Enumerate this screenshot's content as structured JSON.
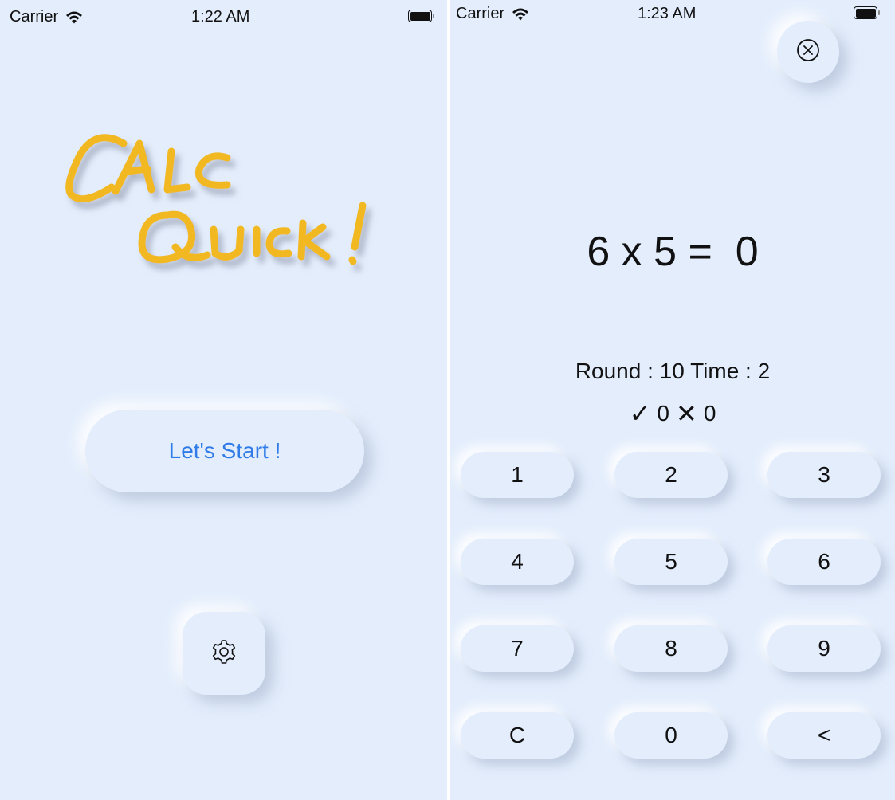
{
  "home": {
    "status_bar": {
      "carrier": "Carrier",
      "time": "1:22 AM"
    },
    "logo": {
      "line1": "CALC",
      "line2": "QUICK !",
      "color": "#f2b824"
    },
    "start_button_label": "Let's Start !",
    "settings_icon": "gear-icon",
    "accent_color": "#2f7be8"
  },
  "game": {
    "status_bar": {
      "carrier": "Carrier",
      "time": "1:23 AM"
    },
    "close_icon": "circled-x-icon",
    "equation": "6 x 5 =  0",
    "round_text": "Round : 10  Time : 2",
    "correct_symbol": "✓",
    "correct_count": "0",
    "wrong_symbol": "✕",
    "wrong_count": "0",
    "keys": [
      [
        "1",
        "2",
        "3"
      ],
      [
        "4",
        "5",
        "6"
      ],
      [
        "7",
        "8",
        "9"
      ],
      [
        "C",
        "0",
        "<"
      ]
    ]
  },
  "background_color": "#e3edfc"
}
